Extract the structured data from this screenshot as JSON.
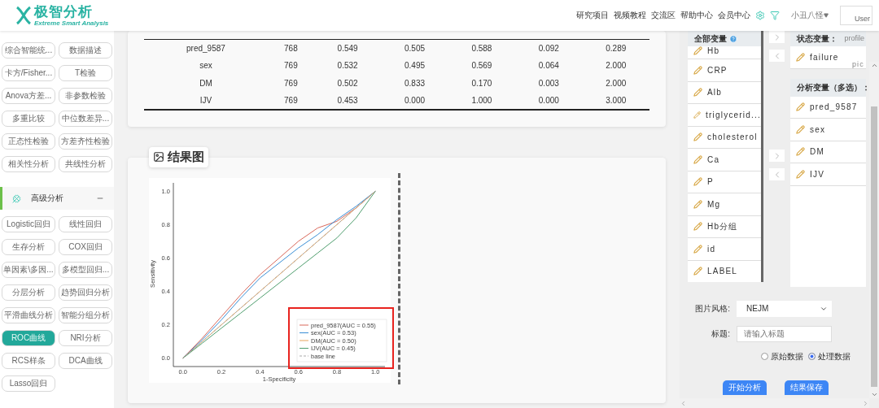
{
  "header": {
    "logo": {
      "name": "极智分析",
      "tagline": "Extreme Smart Analysis"
    },
    "nav": [
      "研究项目",
      "视频教程",
      "交流区",
      "帮助中心",
      "会员中心"
    ],
    "user": {
      "name": "小丑八怪",
      "avatar_alt": "User"
    }
  },
  "sidebar": {
    "groups": [
      {
        "buttons": [
          {
            "label": "综合智能统...",
            "selected": false
          },
          {
            "label": "数据描述",
            "selected": false
          },
          {
            "label": "卡方/Fisher...",
            "selected": false
          },
          {
            "label": "T检验",
            "selected": false
          },
          {
            "label": "Anova方差...",
            "selected": false
          },
          {
            "label": "非参数检验",
            "selected": false
          },
          {
            "label": "多重比较",
            "selected": false
          },
          {
            "label": "中位数差异...",
            "selected": false
          },
          {
            "label": "正态性检验",
            "selected": false
          },
          {
            "label": "方差齐性检验",
            "selected": false
          },
          {
            "label": "相关性分析",
            "selected": false
          },
          {
            "label": "共线性分析",
            "selected": false
          }
        ]
      },
      {
        "title": "高级分析",
        "expanded": true,
        "buttons": [
          {
            "label": "Logistic回归",
            "selected": false
          },
          {
            "label": "线性回归",
            "selected": false
          },
          {
            "label": "生存分析",
            "selected": false
          },
          {
            "label": "COX回归",
            "selected": false
          },
          {
            "label": "单因素\\多因...",
            "selected": false
          },
          {
            "label": "多模型回归...",
            "selected": false
          },
          {
            "label": "分层分析",
            "selected": false
          },
          {
            "label": "趋势回归分析",
            "selected": false
          },
          {
            "label": "平滑曲线分析",
            "selected": false
          },
          {
            "label": "智能分组分析",
            "selected": false
          },
          {
            "label": "ROC曲线",
            "selected": true
          },
          {
            "label": "NRI分析",
            "selected": false
          },
          {
            "label": "RCS样条",
            "selected": false
          },
          {
            "label": "DCA曲线",
            "selected": false
          },
          {
            "label": "Lasso回归",
            "selected": false
          }
        ]
      }
    ]
  },
  "stats_table": {
    "rows": [
      [
        "pred_9587",
        "768",
        "0.549",
        "0.505",
        "0.588",
        "0.092",
        "0.289"
      ],
      [
        "sex",
        "769",
        "0.532",
        "0.495",
        "0.569",
        "0.064",
        "2.000"
      ],
      [
        "DM",
        "769",
        "0.502",
        "0.833",
        "0.170",
        "0.003",
        "2.000"
      ],
      [
        "IJV",
        "769",
        "0.453",
        "0.000",
        "1.000",
        "0.000",
        "3.000"
      ]
    ]
  },
  "result": {
    "title": "结果图",
    "chart_data": {
      "type": "line",
      "xlabel": "1-Specificity",
      "ylabel": "Sensitivity",
      "x": [
        0,
        0.1,
        0.2,
        0.3,
        0.4,
        0.5,
        0.6,
        0.7,
        0.8,
        0.9,
        1
      ],
      "xlim": [
        -0.05,
        1.05
      ],
      "ylim": [
        -0.05,
        1.05
      ],
      "legend": "lower right",
      "xticks": [
        {
          "value": 0,
          "label": "0.0"
        },
        {
          "value": 0.2,
          "label": "0.2"
        },
        {
          "value": 0.4,
          "label": "0.4"
        },
        {
          "value": 0.6,
          "label": "0.6"
        },
        {
          "value": 0.8,
          "label": "0.8"
        },
        {
          "value": 1,
          "label": "1.0"
        }
      ],
      "yticks": [
        {
          "value": 0,
          "label": "0.0"
        },
        {
          "value": 0.2,
          "label": "0.2"
        },
        {
          "value": 0.4,
          "label": "0.4"
        },
        {
          "value": 0.6,
          "label": "0.6"
        },
        {
          "value": 0.8,
          "label": "0.8"
        },
        {
          "value": 1,
          "label": "1.0"
        }
      ],
      "series": [
        {
          "name": "pred_9587(AUC = 0.55)",
          "color": "#d9685a",
          "values": [
            0,
            0.12,
            0.25,
            0.38,
            0.5,
            0.6,
            0.7,
            0.78,
            0.82,
            0.9,
            1
          ]
        },
        {
          "name": "sex(AUC = 0.53)",
          "color": "#3a8fd6",
          "values": [
            0,
            0.11,
            0.23,
            0.36,
            0.48,
            0.57,
            0.66,
            0.74,
            0.83,
            0.91,
            1
          ]
        },
        {
          "name": "DM(AUC = 0.50)",
          "color": "#e8a45c",
          "values": [
            0,
            0.1,
            0.2,
            0.3,
            0.4,
            0.5,
            0.6,
            0.7,
            0.8,
            0.9,
            1
          ]
        },
        {
          "name": "IJV(AUC = 0.45)",
          "color": "#4f9e6e",
          "values": [
            0,
            0.09,
            0.18,
            0.27,
            0.36,
            0.45,
            0.54,
            0.63,
            0.72,
            0.84,
            1
          ]
        },
        {
          "name": "base line",
          "color": "#aaaaaa",
          "line_style": "dashed",
          "values": [
            0,
            0.1,
            0.2,
            0.3,
            0.4,
            0.5,
            0.6,
            0.7,
            0.8,
            0.9,
            1
          ]
        }
      ]
    }
  },
  "variables": {
    "all": {
      "title": "全部变量",
      "items": [
        "Hb",
        "CRP",
        "Alb",
        "triglycerid...",
        "cholesterol",
        "Ca",
        "P",
        "Mg",
        "Hb分组",
        "id",
        "LABEL"
      ]
    },
    "status": {
      "title": "状态变量：",
      "broken_images": [
        "profile",
        "pic"
      ],
      "items": [
        "failure"
      ]
    },
    "analysis": {
      "title": "分析变量（多选）：",
      "items": [
        "pred_9587",
        "sex",
        "DM",
        "IJV"
      ]
    }
  },
  "form": {
    "style": {
      "label": "图片风格:",
      "value": "NEJM"
    },
    "title": {
      "label": "标题:",
      "placeholder": "请输入标题"
    },
    "data_source": [
      {
        "label": "原始数据",
        "selected": false
      },
      {
        "label": "处理数据",
        "selected": true
      }
    ],
    "buttons": [
      "开始分析",
      "结果保存"
    ]
  }
}
